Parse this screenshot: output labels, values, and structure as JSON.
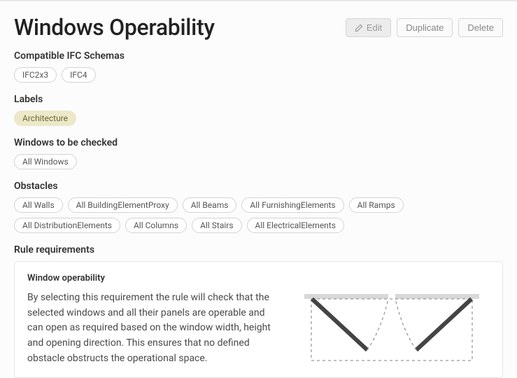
{
  "header": {
    "title": "Windows Operability",
    "edit_label": "Edit",
    "duplicate_label": "Duplicate",
    "delete_label": "Delete"
  },
  "sections": {
    "schemas": {
      "title": "Compatible IFC Schemas",
      "items": [
        "IFC2x3",
        "IFC4"
      ]
    },
    "labels": {
      "title": "Labels",
      "items": [
        "Architecture"
      ]
    },
    "windows": {
      "title": "Windows to be checked",
      "items": [
        "All Windows"
      ]
    },
    "obstacles": {
      "title": "Obstacles",
      "items": [
        "All Walls",
        "All BuildingElementProxy",
        "All Beams",
        "All FurnishingElements",
        "All Ramps",
        "All DistributionElements",
        "All Columns",
        "All Stairs",
        "All ElectricalElements"
      ]
    }
  },
  "requirements": {
    "title": "Rule requirements",
    "card": {
      "title": "Window operability",
      "description": "By selecting this requirement the rule will check that the selected windows and all their panels are operable and can open as required based on the window width, height and opening direction. This ensures that no defined obstacle obstructs the operational space."
    }
  }
}
